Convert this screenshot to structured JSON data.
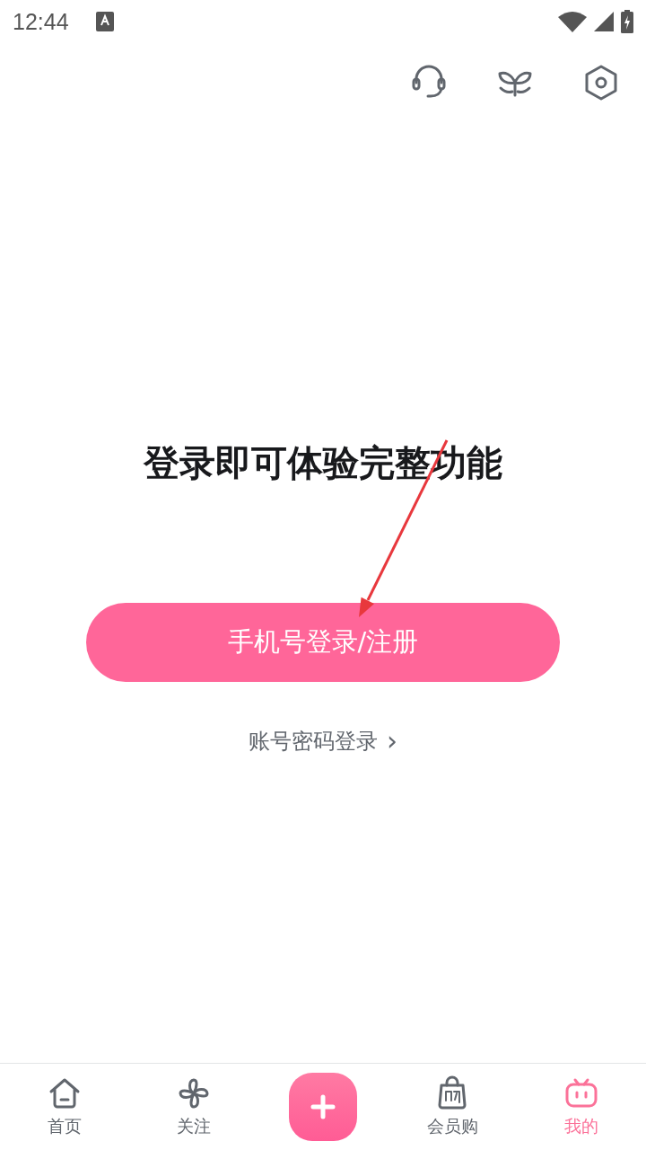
{
  "status_bar": {
    "time": "12:44"
  },
  "headline": "登录即可体验完整功能",
  "primary_button": "手机号登录/注册",
  "secondary_link": {
    "label": "账号密码登录",
    "chevron": "›"
  },
  "bottom_nav": [
    {
      "kind": "home",
      "label": "首页",
      "selected": false
    },
    {
      "kind": "follow",
      "label": "关注",
      "selected": false
    },
    {
      "kind": "compose",
      "selected": false
    },
    {
      "kind": "shop",
      "label": "会员购",
      "selected": false
    },
    {
      "kind": "mine",
      "label": "我的",
      "selected": true
    }
  ]
}
